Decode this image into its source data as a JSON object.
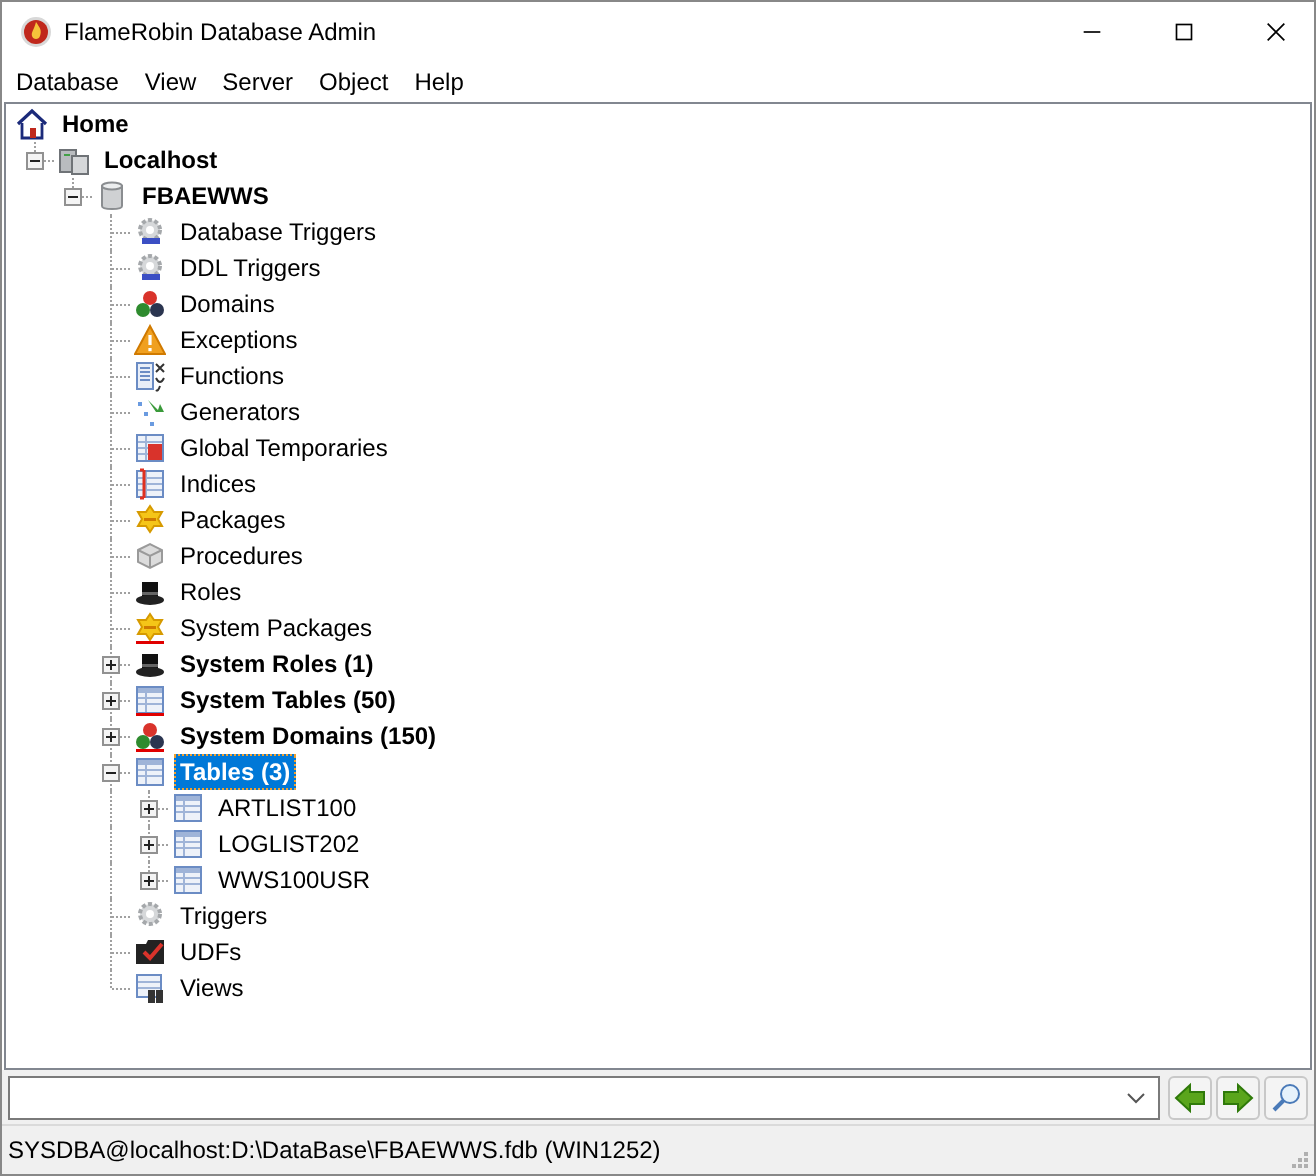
{
  "window": {
    "title": "FlameRobin Database Admin"
  },
  "menu": [
    "Database",
    "View",
    "Server",
    "Object",
    "Help"
  ],
  "tree": [
    {
      "label": "Home",
      "kind": "home",
      "bold": true,
      "selected": false,
      "children": [
        {
          "label": "Localhost",
          "kind": "server",
          "bold": true,
          "selected": false,
          "expanded": true,
          "children": [
            {
              "label": "FBAEWWS",
              "kind": "database",
              "bold": true,
              "selected": false,
              "expanded": true,
              "children": [
                {
                  "label": "Database Triggers",
                  "kind": "dbtrigger",
                  "bold": false,
                  "selected": false
                },
                {
                  "label": "DDL Triggers",
                  "kind": "ddltrigger",
                  "bold": false,
                  "selected": false
                },
                {
                  "label": "Domains",
                  "kind": "domain",
                  "bold": false,
                  "selected": false
                },
                {
                  "label": "Exceptions",
                  "kind": "exception",
                  "bold": false,
                  "selected": false
                },
                {
                  "label": "Functions",
                  "kind": "function",
                  "bold": false,
                  "selected": false
                },
                {
                  "label": "Generators",
                  "kind": "generator",
                  "bold": false,
                  "selected": false
                },
                {
                  "label": "Global Temporaries",
                  "kind": "globaltemp",
                  "bold": false,
                  "selected": false
                },
                {
                  "label": "Indices",
                  "kind": "index",
                  "bold": false,
                  "selected": false
                },
                {
                  "label": "Packages",
                  "kind": "package",
                  "bold": false,
                  "selected": false
                },
                {
                  "label": "Procedures",
                  "kind": "procedure",
                  "bold": false,
                  "selected": false
                },
                {
                  "label": "Roles",
                  "kind": "role",
                  "bold": false,
                  "selected": false
                },
                {
                  "label": "System Packages",
                  "kind": "syspackage",
                  "bold": false,
                  "selected": false
                },
                {
                  "label": "System Roles (1)",
                  "kind": "role",
                  "bold": true,
                  "selected": false,
                  "expanded": false
                },
                {
                  "label": "System Tables (50)",
                  "kind": "systable",
                  "bold": true,
                  "selected": false,
                  "expanded": false
                },
                {
                  "label": "System Domains (150)",
                  "kind": "sysdomain",
                  "bold": true,
                  "selected": false,
                  "expanded": false
                },
                {
                  "label": "Tables (3)",
                  "kind": "table",
                  "bold": true,
                  "selected": true,
                  "expanded": true,
                  "children": [
                    {
                      "label": "ARTLIST100",
                      "kind": "table",
                      "bold": false,
                      "selected": false,
                      "expanded": false
                    },
                    {
                      "label": "LOGLIST202",
                      "kind": "table",
                      "bold": false,
                      "selected": false,
                      "expanded": false
                    },
                    {
                      "label": "WWS100USR",
                      "kind": "table",
                      "bold": false,
                      "selected": false,
                      "expanded": false
                    }
                  ]
                },
                {
                  "label": "Triggers",
                  "kind": "trigger",
                  "bold": false,
                  "selected": false
                },
                {
                  "label": "UDFs",
                  "kind": "udf",
                  "bold": false,
                  "selected": false
                },
                {
                  "label": "Views",
                  "kind": "view",
                  "bold": false,
                  "selected": false
                }
              ]
            }
          ]
        }
      ]
    }
  ],
  "status_bar": "SYSDBA@localhost:D:\\DataBase\\FBAEWWS.fdb (WIN1252)"
}
